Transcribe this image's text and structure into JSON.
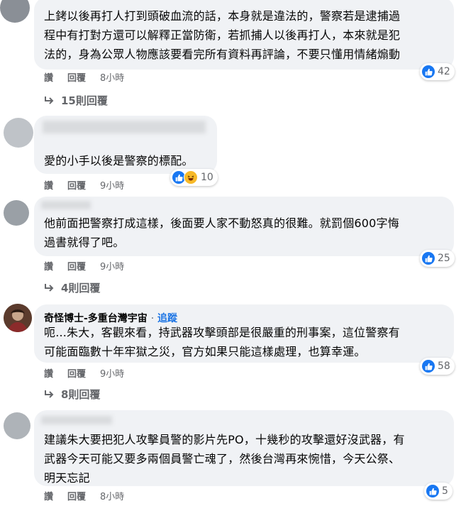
{
  "comments": [
    {
      "text_lines": [
        "上銬以後再打人打到頭破血流的話，本身就是違法的，警察若是逮捕過",
        "程中有打對方還可以解釋正當防衛，若抓捕人以後再打人，本來就是犯",
        "法的，身為公眾人物應該要看完所有資料再評論，不要只懂用情緒煽動"
      ],
      "actions": {
        "like": "讚",
        "reply": "回覆",
        "time": "8小時"
      },
      "reactions": {
        "count": "42",
        "icons": [
          "like-icon"
        ]
      },
      "replies_label": "15則回覆"
    },
    {
      "text_lines": [
        "愛的小手以後是警察的標配。"
      ],
      "actions": {
        "like": "讚",
        "reply": "回覆",
        "time": "9小時"
      },
      "reactions": {
        "count": "10",
        "icons": [
          "like-icon",
          "haha-icon"
        ]
      }
    },
    {
      "text_lines": [
        "他前面把警察打成這樣，後面要人家不動怒真的很難。就罰個600字悔",
        "過書就得了吧。"
      ],
      "actions": {
        "like": "讚",
        "reply": "回覆",
        "time": "9小時"
      },
      "reactions": {
        "count": "25",
        "icons": [
          "like-icon"
        ]
      },
      "replies_label": "4則回覆"
    },
    {
      "author": "奇怪博士-多重台灣宇宙",
      "separator": "·",
      "follow": "追蹤",
      "text_lines": [
        "呃...朱大，客觀來看，持武器攻擊頭部是很嚴重的刑事案，這位警察有",
        "可能面臨數十年牢獄之災，官方如果只能這樣處理，也算幸運。"
      ],
      "actions": {
        "like": "讚",
        "reply": "回覆",
        "time": "9小時"
      },
      "reactions": {
        "count": "58",
        "icons": [
          "like-icon"
        ]
      },
      "replies_label": "8則回覆"
    },
    {
      "text_lines": [
        "建議朱大要把犯人攻擊員警的影片先PO，十幾秒的攻擊還好沒武器，有",
        "武器今天可能又要多兩個員警亡魂了，然後台灣再來惋惜，今天公祭、",
        "明天忘記"
      ],
      "actions": {
        "like": "讚",
        "reply": "回覆",
        "time": "8小時"
      },
      "reactions": {
        "count": "5",
        "icons": [
          "like-icon"
        ]
      }
    }
  ],
  "colors": {
    "bubble": "#f0f2f5",
    "like_blue": "#1877f2",
    "meta_gray": "#65676b",
    "follow_blue": "#1b74e4"
  }
}
